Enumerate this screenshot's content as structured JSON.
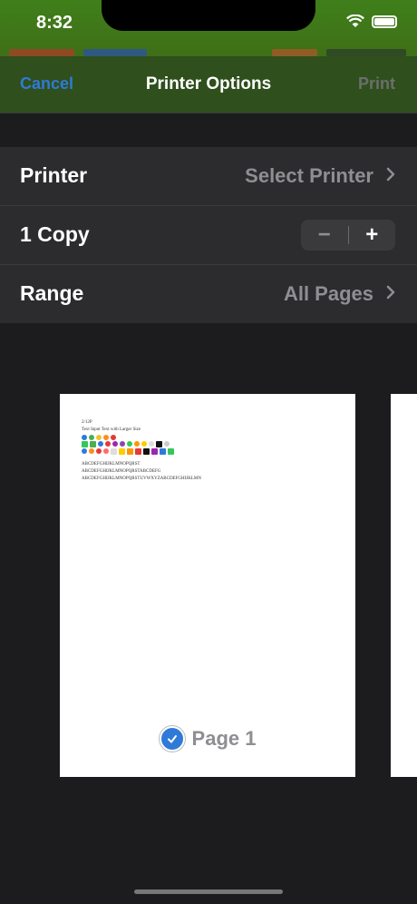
{
  "status": {
    "time": "8:32"
  },
  "nav": {
    "cancel": "Cancel",
    "title": "Printer Options",
    "print": "Print"
  },
  "options": {
    "printer": {
      "label": "Printer",
      "value": "Select Printer"
    },
    "copies": {
      "label": "1 Copy",
      "minus": "−",
      "plus": "+"
    },
    "range": {
      "label": "Range",
      "value": "All Pages"
    }
  },
  "preview": {
    "lines": [
      "2/12P",
      "Text Input Text with Larger Size",
      "ABCDEFGHIJKLMNOPQRST",
      "ABCDEFGHIJKLMNOPQRSTABCDEFG",
      "ABCDEFGHIJKLMNOPQRSTUVWXYZABCDEFGHIJKLMN"
    ],
    "page_label": "Page 1"
  },
  "colors": {
    "accent": "#2f7ad8",
    "nav_bg": "#2f4f1c",
    "cell_bg": "#2c2c2e"
  }
}
